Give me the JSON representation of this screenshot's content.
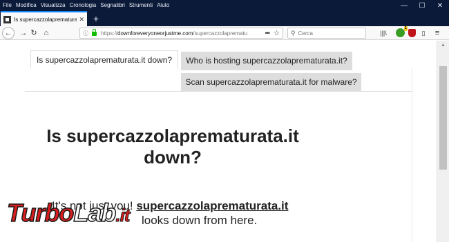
{
  "menu": [
    "File",
    "Modifica",
    "Visualizza",
    "Cronologia",
    "Segnalibri",
    "Strumenti",
    "Aiuto"
  ],
  "window_controls": {
    "minimize": "—",
    "maximize": "☐",
    "close": "✕"
  },
  "browser_tab": {
    "title": "Is supercazzolaprematurata.it d",
    "close": "✕",
    "new_tab": "+"
  },
  "toolbar": {
    "back": "←",
    "forward": "→",
    "reload": "↻",
    "home": "⌂",
    "url_scheme": "https://",
    "url_host": "downforeveryoneorjustme.com",
    "url_path": "/supercazzolaprematu",
    "page_actions": "•••",
    "bookmark": "☆",
    "search_placeholder": "Cerca",
    "library": "|||\\",
    "ext_badge_count": "1",
    "sidebar": "▯",
    "menu": "≡"
  },
  "page": {
    "tabs": [
      {
        "label": "Is supercazzolaprematurata.it down?",
        "active": true
      },
      {
        "label": "Who is hosting supercazzolaprematurata.it?",
        "active": false
      },
      {
        "label": "Scan supercazzolaprematurata.it for malware?",
        "active": false
      }
    ],
    "headline": "Is supercazzolaprematurata.it down?",
    "result_prefix": "It's not just you! ",
    "result_site": "supercazzolaprematurata.it",
    "result_suffix": "looks down from here."
  },
  "watermark": {
    "turbo": "Turbo",
    "lab": "Lab",
    "tld": ".it"
  },
  "colors": {
    "titlebar": "#0c1a3a",
    "tab_accent": "#0a84ff",
    "lock": "#12bc00",
    "watermark_red": "#d81e1e",
    "inactive_tab": "#dddddd"
  }
}
